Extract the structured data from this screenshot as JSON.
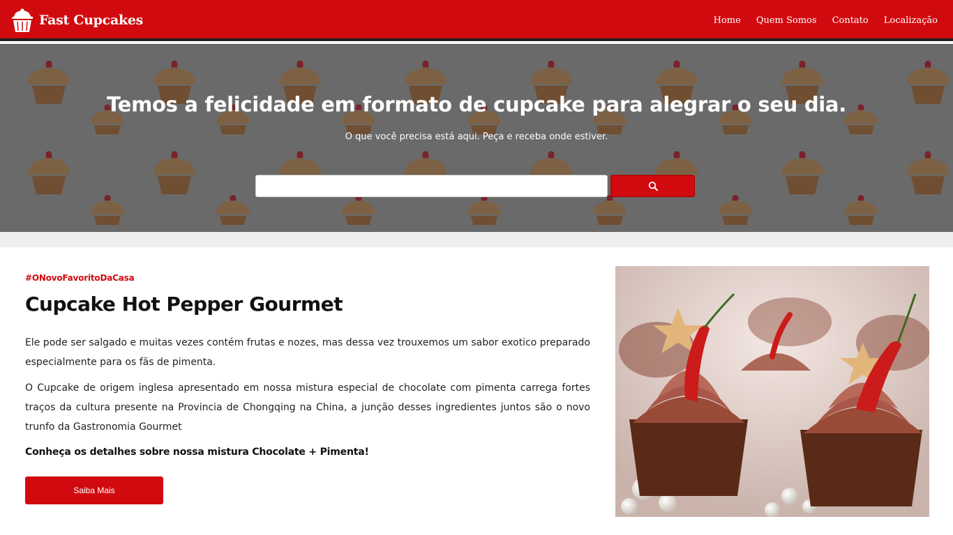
{
  "brand": {
    "name": "Fast Cupcakes"
  },
  "nav": {
    "items": [
      {
        "label": "Home"
      },
      {
        "label": "Quem Somos"
      },
      {
        "label": "Contato"
      },
      {
        "label": "Localização"
      }
    ]
  },
  "hero": {
    "title": "Temos a felicidade em formato de cupcake para alegrar o seu dia.",
    "subtitle": "O que você precisa está aqui. Peça e receba onde estiver.",
    "search": {
      "value": "",
      "placeholder": "",
      "button_icon": "search-icon"
    }
  },
  "feature": {
    "tag": "#ONovoFavoritoDaCasa",
    "title": "Cupcake Hot Pepper Gourmet",
    "paragraphs": [
      "Ele pode ser salgado e muitas vezes contém frutas e nozes, mas dessa vez trouxemos um sabor exotico preparado especialmente para os fãs de pimenta.",
      "O Cupcake de origem inglesa apresentado em nossa mistura especial de chocolate com pimenta carrega fortes traços da cultura presente na Provincia de Chongqing na China, a junção desses ingredientes juntos são o novo trunfo da Gastronomia Gourmet"
    ],
    "cta": "Conheça os detalhes sobre nossa mistura Chocolate + Pimenta!",
    "button": "Saiba Mais"
  },
  "colors": {
    "primary": "#d10a0f",
    "navbar_border": "#1f1f1f",
    "strip": "#eeeeee",
    "text": "#222222"
  }
}
